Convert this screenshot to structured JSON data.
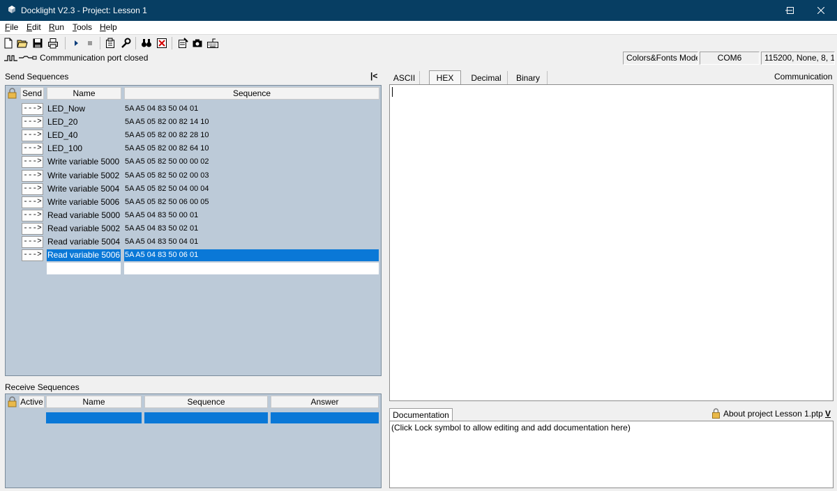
{
  "window": {
    "title": "Docklight V2.3 - Project: Lesson 1",
    "minimize_label": "─",
    "maximize_label": "☐",
    "close_label": "✕"
  },
  "menu": [
    {
      "label": "File",
      "accel": "F",
      "rest": "ile"
    },
    {
      "label": "Edit",
      "accel": "E",
      "rest": "dit"
    },
    {
      "label": "Run",
      "accel": "R",
      "rest": "un"
    },
    {
      "label": "Tools",
      "accel": "T",
      "rest": "ools"
    },
    {
      "label": "Help",
      "accel": "H",
      "rest": "elp"
    }
  ],
  "toolbar_icons": [
    "new-file-icon",
    "open-folder-icon",
    "save-icon",
    "print-icon",
    "play-icon",
    "stop-icon",
    "project-settings-icon",
    "wrench-icon",
    "binoculars-icon",
    "stop-comm-icon",
    "notepad-icon",
    "camera-icon",
    "keyboard-icon"
  ],
  "status": {
    "port_text": "Commmunication port closed",
    "mode": "Colors&Fonts Mode",
    "com_port": "COM6",
    "settings": "115200, None, 8, 1"
  },
  "send_sequences": {
    "label": "Send Sequences",
    "collapse_label": "|<",
    "headers": {
      "send": "Send",
      "name": "Name",
      "sequence": "Sequence"
    },
    "send_button_label": "--->",
    "rows": [
      {
        "name": "LED_Now",
        "sequence": "5A A5 04 83 50 04 01"
      },
      {
        "name": "LED_20",
        "sequence": "5A A5 05 82 00 82 14 10"
      },
      {
        "name": "LED_40",
        "sequence": "5A A5 05 82 00 82 28 10"
      },
      {
        "name": "LED_100",
        "sequence": "5A A5 05 82 00 82 64 10"
      },
      {
        "name": "Write variable 5000",
        "sequence": "5A A5 05 82 50 00 00 02"
      },
      {
        "name": "Write variable 5002",
        "sequence": "5A A5 05 82 50 02 00 03"
      },
      {
        "name": "Write variable 5004",
        "sequence": "5A A5 05 82 50 04 00 04"
      },
      {
        "name": "Write variable 5006",
        "sequence": "5A A5 05 82 50 06 00 05"
      },
      {
        "name": "Read variable 5000",
        "sequence": "5A A5 04 83 50 00 01"
      },
      {
        "name": "Read variable 5002",
        "sequence": "5A A5 04 83 50 02 01"
      },
      {
        "name": "Read variable 5004",
        "sequence": "5A A5 04 83 50 04 01"
      },
      {
        "name": "Read variable 5006",
        "sequence": "5A A5 04 83 50 06 01"
      }
    ],
    "selected_index": 11
  },
  "receive_sequences": {
    "label": "Receive Sequences",
    "headers": {
      "active": "Active",
      "name": "Name",
      "sequence": "Sequence",
      "answer": "Answer"
    }
  },
  "communication": {
    "label": "Communication",
    "tabs": [
      "ASCII",
      "HEX",
      "Decimal",
      "Binary"
    ],
    "active_tab": "HEX"
  },
  "documentation": {
    "tab_label": "Documentation",
    "about_label": "About project Lesson 1.ptp",
    "expand_label": "V",
    "text": "(Click Lock symbol to allow editing and add documentation here)"
  },
  "colors": {
    "titlebar": "#073e63",
    "grid_background": "#bccad8",
    "selection": "#0a78d7"
  }
}
